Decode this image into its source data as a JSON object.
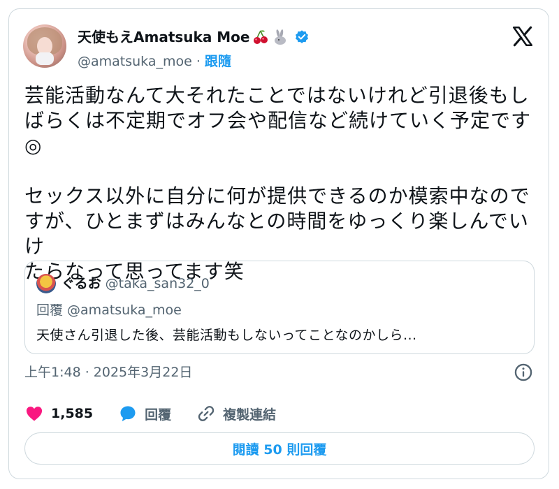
{
  "author": {
    "display_name": "天使もえAmatsuka Moe",
    "emoji_icons": [
      "cherries-icon",
      "rabbit-icon"
    ],
    "handle": "@amatsuka_moe",
    "separator": "·",
    "follow_label": "跟隨",
    "verified": true
  },
  "tweet": {
    "text": "芸能活動なんて大それたことではないけれど引退後もし\nばらくは不定期でオフ会や配信など続けていく予定です\n◎\n\nセックス以外に自分に何が提供できるのか模索中なので\nすが、ひとまずはみんなとの時間をゆっくり楽しんでいけ\nたらなって思ってます笑",
    "timestamp": "上午1:48 · 2025年3月22日"
  },
  "quoted": {
    "name": "ぐるお",
    "handle": "@taka_san32_0",
    "reply_to": "回覆 @amatsuka_moe",
    "text": "天使さん引退した後、芸能活動もしないってことなのかしら..."
  },
  "actions": {
    "likes": "1,585",
    "reply_label": "回覆",
    "copy_link_label": "複製連結"
  },
  "read_replies_label": "閱讀 50 則回覆",
  "colors": {
    "accent": "#1d9bf0",
    "like": "#f91880",
    "secondary_text": "#536471",
    "border": "#cfd9de"
  }
}
